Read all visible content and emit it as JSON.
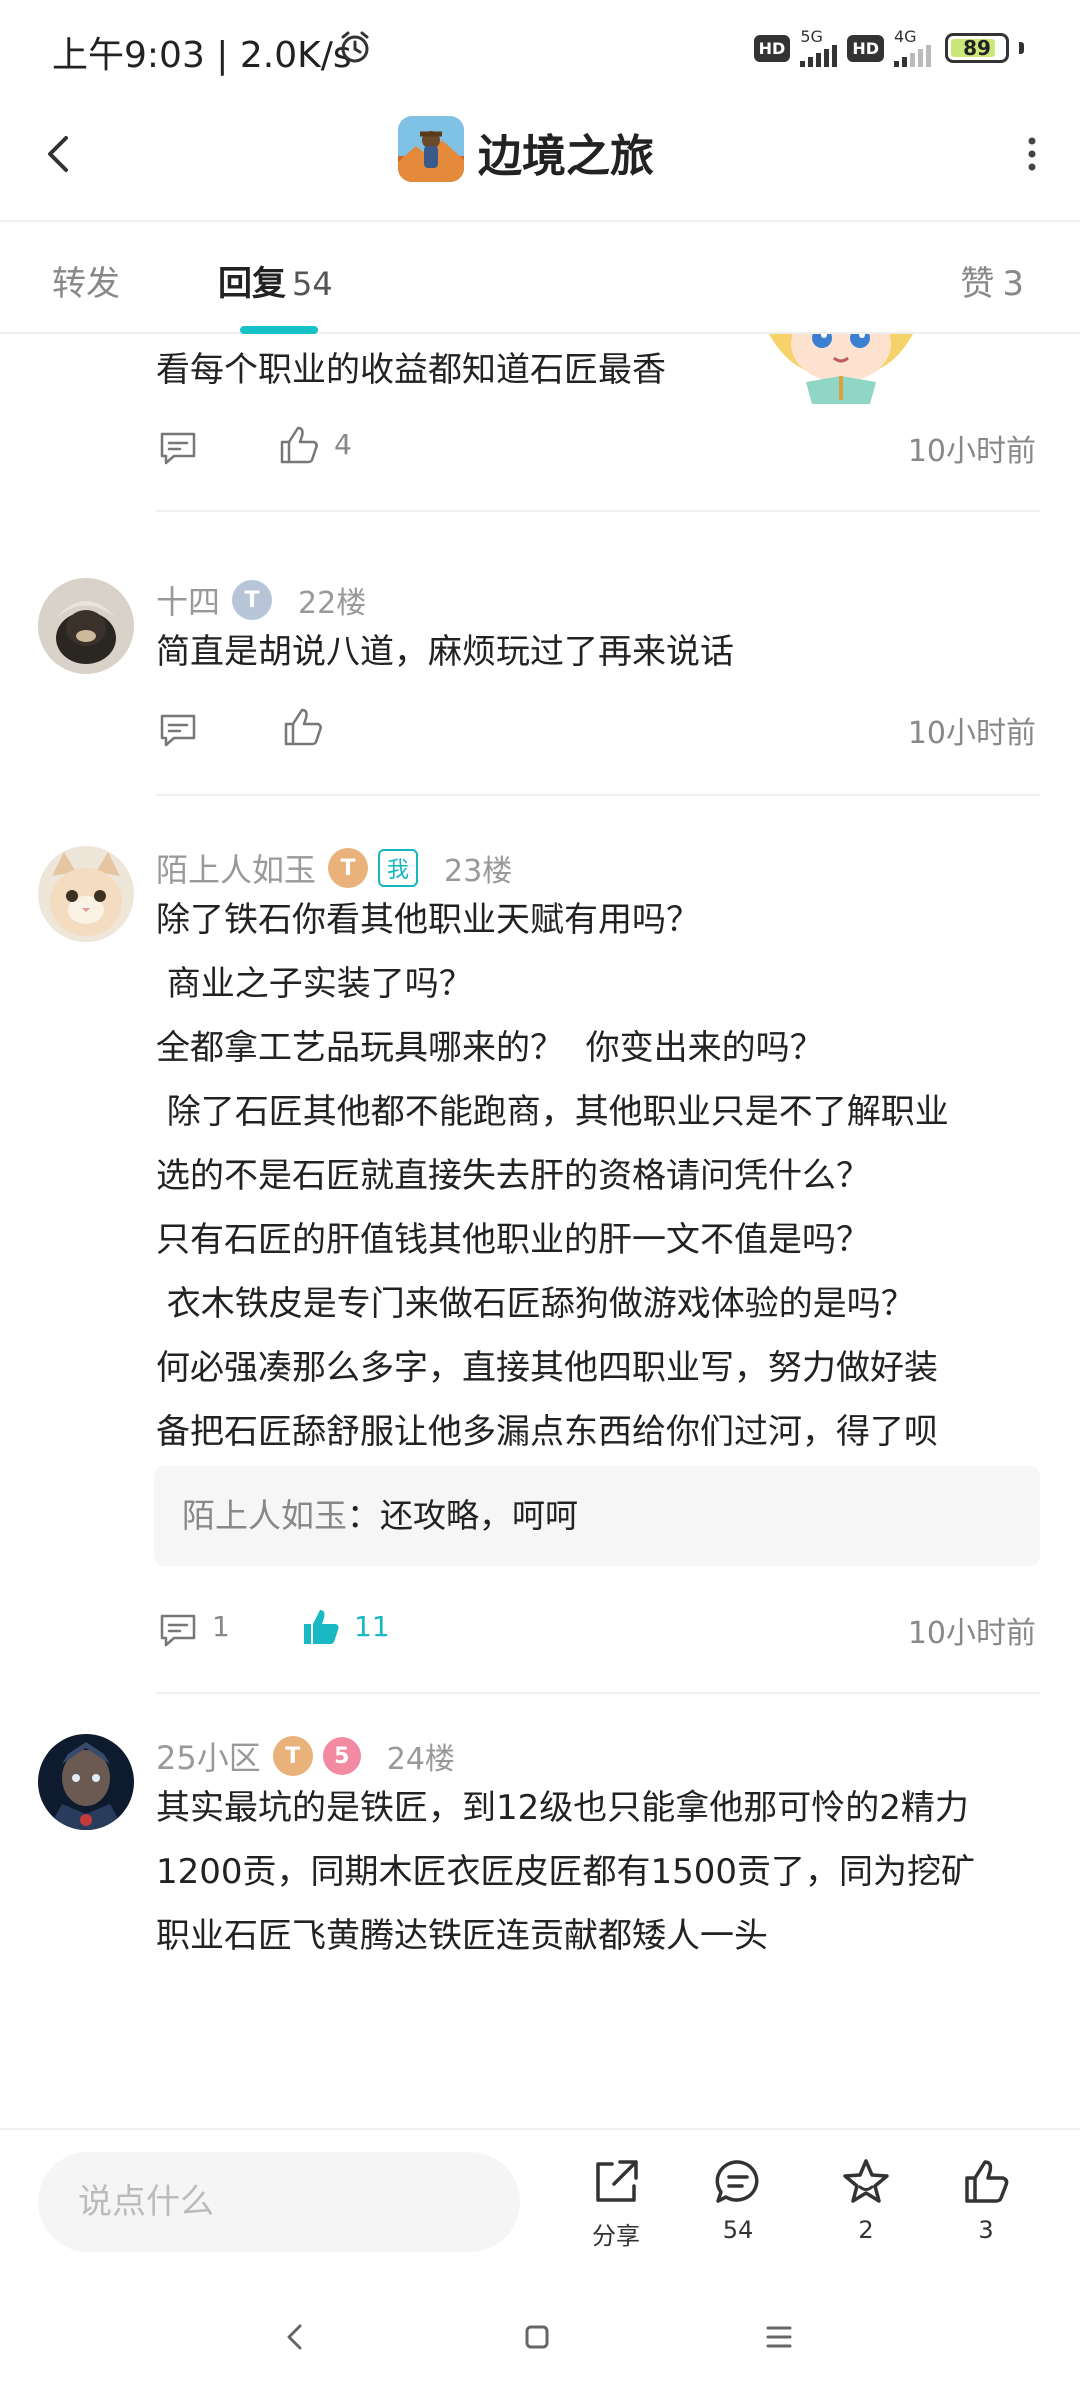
{
  "status_bar": {
    "time": "上午9:03 | 2.0K/s",
    "hd1": "HD",
    "net1": "5G",
    "hd2": "HD",
    "net2": "4G",
    "battery": "89",
    "icons": [
      "alarm-icon",
      "signal-icon",
      "battery-icon"
    ]
  },
  "header": {
    "title": "边境之旅",
    "icons": [
      "back-arrow-icon",
      "game-icon",
      "more-vertical-icon"
    ]
  },
  "tabs": {
    "repost": {
      "label": "转发"
    },
    "reply": {
      "label": "回复",
      "count": "54"
    },
    "like": {
      "label": "赞",
      "count": "3"
    },
    "active": "reply",
    "accent": "#14c2c8"
  },
  "comments": [
    {
      "body": [
        "看每个职业的收益都知道石匠最香"
      ],
      "reply_count": "",
      "like_count": "4",
      "time": "10小时前"
    },
    {
      "user": "十四",
      "badge": "T",
      "floor": "22楼",
      "body": [
        "简直是胡说八道，麻烦玩过了再来说话"
      ],
      "reply_count": "",
      "like_count": "",
      "time": "10小时前"
    },
    {
      "user": "陌上人如玉",
      "badge": "T",
      "me_badge": "我",
      "floor": "23楼",
      "body": [
        "除了铁石你看其他职业天赋有用吗？",
        " 商业之子实装了吗？",
        "全都拿工艺品玩具哪来的？  你变出来的吗？",
        " 除了石匠其他都不能跑商，其他职业只是不了解职业",
        "选的不是石匠就直接失去肝的资格请问凭什么？",
        "只有石匠的肝值钱其他职业的肝一文不值是吗？",
        " 衣木铁皮是专门来做石匠舔狗做游戏体验的是吗？",
        "何必强凑那么多字，直接其他四职业写，努力做好装",
        "备把石匠舔舒服让他多漏点东西给你们过河，得了呗"
      ],
      "quote": {
        "user": "陌上人如玉",
        "sep": "：",
        "text": "还攻略，呵呵"
      },
      "reply_count": "1",
      "like_count": "11",
      "liked": true,
      "time": "10小时前"
    },
    {
      "user": "25小区",
      "badge": "T",
      "floor": "24楼",
      "body": [
        "其实最坑的是铁匠，到12级也只能拿他那可怜的2精力",
        "1200贡，同期木匠衣匠皮匠都有1500贡了，同为挖矿",
        "职业石匠飞黄腾达铁匠连贡献都矮人一头"
      ]
    }
  ],
  "bottom_bar": {
    "input_placeholder": "说点什么",
    "share_label": "分享",
    "comment_count": "54",
    "star_count": "2",
    "like_count": "3"
  },
  "nav_bar": {
    "icons": [
      "nav-back-icon",
      "nav-home-icon",
      "nav-menu-icon"
    ]
  }
}
